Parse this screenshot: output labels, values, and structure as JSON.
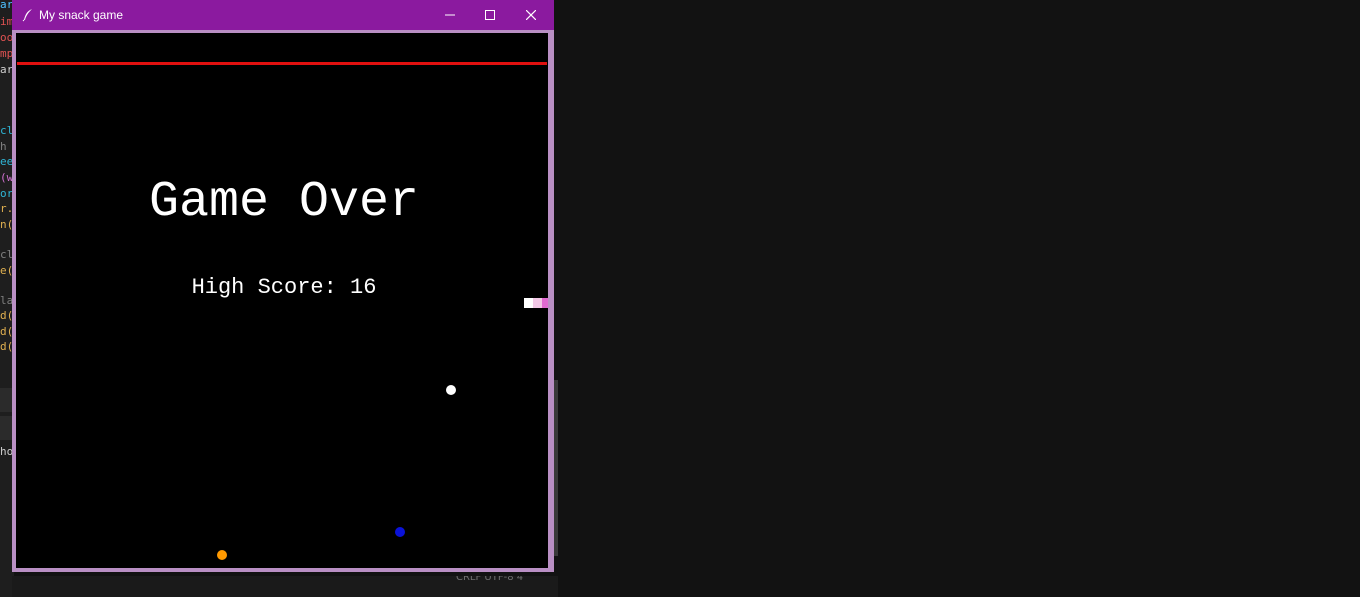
{
  "window": {
    "title": "My snack game",
    "titlebar_color": "#8b1a9f",
    "icon": "feather-icon",
    "minimize_icon": "minimize-icon",
    "maximize_icon": "maximize-icon",
    "close_icon": "close-icon"
  },
  "game": {
    "title_text": "Game Over",
    "score_text": "High Score: 16",
    "background_color": "#000000",
    "border_line_color": "#e0100f",
    "snake_colors": [
      "#ffffff",
      "#f2c8e6",
      "#e06ad0"
    ],
    "food_colors": {
      "white_food": "#ffffff",
      "blue_food": "#0a12d8",
      "orange_food": "#ff9900"
    }
  },
  "background_editor": {
    "code_fragments": [
      "ard",
      "im",
      "oo",
      "mp",
      "ar",
      "",
      "",
      "cl",
      "h",
      "ee",
      "(w",
      "or",
      "r.",
      "n(",
      "",
      "cl",
      "e(",
      "",
      "la",
      "d(",
      "d(",
      "d("
    ],
    "terminal_fragment": "ho",
    "status_text": "CRLF   UTF-8   4"
  }
}
